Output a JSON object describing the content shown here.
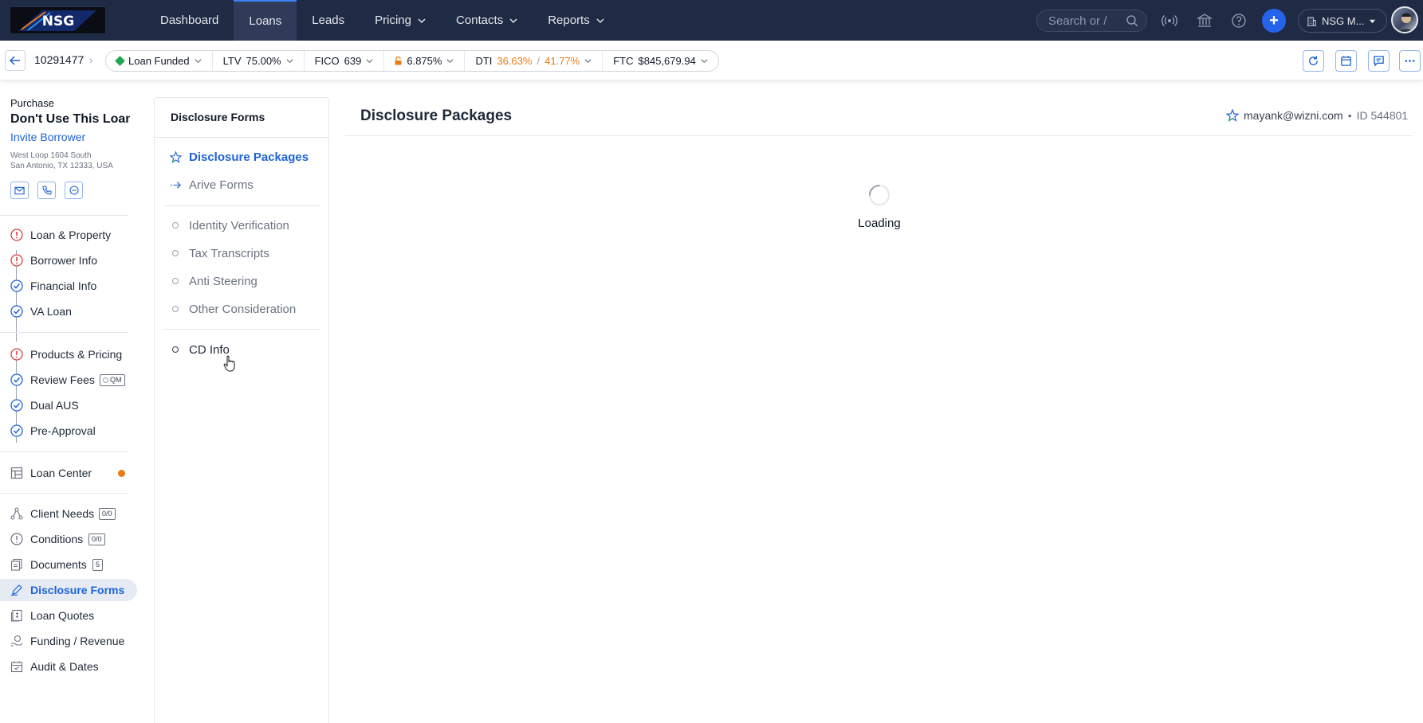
{
  "topnav": {
    "logo_text": "NSG",
    "links": [
      {
        "label": "Dashboard",
        "has_dropdown": false,
        "active": false
      },
      {
        "label": "Loans",
        "has_dropdown": false,
        "active": true
      },
      {
        "label": "Leads",
        "has_dropdown": false,
        "active": false
      },
      {
        "label": "Pricing",
        "has_dropdown": true,
        "active": false
      },
      {
        "label": "Contacts",
        "has_dropdown": true,
        "active": false
      },
      {
        "label": "Reports",
        "has_dropdown": true,
        "active": false
      }
    ],
    "search_placeholder": "Search or /",
    "icons": [
      "broadcast-icon",
      "bank-icon",
      "help-icon"
    ],
    "add_label": "+",
    "org_label": "NSG M...",
    "accent_color": "#2563eb",
    "bg_color": "#1f2a44"
  },
  "loanbar": {
    "loan_number": "10291477",
    "status": "Loan Funded",
    "status_color": "#22a652",
    "ltv_label": "LTV",
    "ltv_value": "75.00%",
    "fico_label": "FICO",
    "fico_value": "639",
    "rate_value": "6.875%",
    "dti_label": "DTI",
    "dti_front": "36.63%",
    "dti_sep": "/",
    "dti_back": "41.77%",
    "ftc_label": "FTC",
    "ftc_value": "$845,679.94",
    "actions": [
      "refresh-icon",
      "calendar-icon",
      "chat-icon",
      "more-icon"
    ]
  },
  "sidebar": {
    "purpose": "Purchase",
    "loan_name": "Don't Use This Loan",
    "invite_label": "Invite Borrower",
    "address_line1": "West Loop 1604 South",
    "address_line2": "San Antonio, TX 12333, USA",
    "group1": [
      {
        "label": "Loan & Property",
        "status": "error"
      },
      {
        "label": "Borrower Info",
        "status": "error"
      },
      {
        "label": "Financial Info",
        "status": "done"
      },
      {
        "label": "VA Loan",
        "status": "done"
      }
    ],
    "group2": [
      {
        "label": "Products & Pricing",
        "status": "error"
      },
      {
        "label": "Review Fees",
        "status": "done",
        "badge": "QM"
      },
      {
        "label": "Dual AUS",
        "status": "done"
      },
      {
        "label": "Pre-Approval",
        "status": "done"
      }
    ],
    "loan_center": "Loan Center",
    "group3": [
      {
        "label": "Client Needs",
        "badge": "0/0"
      },
      {
        "label": "Conditions",
        "badge": "0/0"
      },
      {
        "label": "Documents",
        "badge": "5"
      },
      {
        "label": "Disclosure Forms",
        "active": true
      },
      {
        "label": "Loan Quotes"
      },
      {
        "label": "Funding / Revenue"
      },
      {
        "label": "Audit & Dates"
      }
    ]
  },
  "disclosure_menu": {
    "title": "Disclosure Forms",
    "items_top": [
      {
        "label": "Disclosure Packages",
        "active": true
      },
      {
        "label": "Arive Forms"
      }
    ],
    "items_mid": [
      {
        "label": "Identity Verification"
      },
      {
        "label": "Tax Transcripts"
      },
      {
        "label": "Anti Steering"
      },
      {
        "label": "Other Consideration"
      }
    ],
    "items_bottom": [
      {
        "label": "CD Info"
      }
    ]
  },
  "main": {
    "title": "Disclosure Packages",
    "user_email": "mayank@wizni.com",
    "bullet": "•",
    "id_label": "ID 544801",
    "loading_text": "Loading"
  }
}
